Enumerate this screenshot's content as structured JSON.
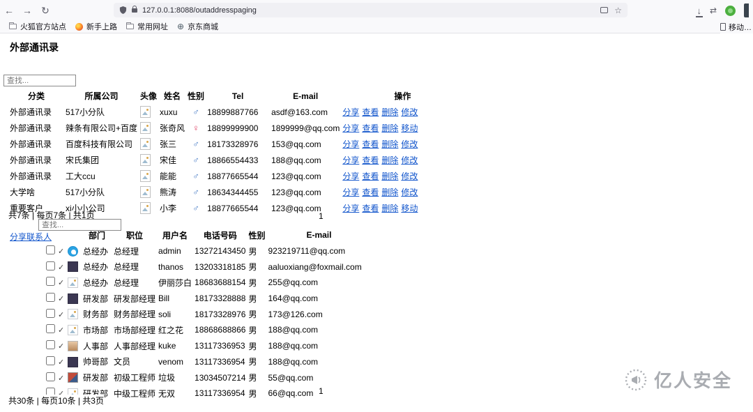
{
  "icons": {
    "back": "←",
    "forward": "→",
    "refresh": "↻",
    "star": "☆",
    "download": "↓",
    "sync": "⇄",
    "globe": "⊕",
    "check": "✓",
    "male": "♂",
    "female": "♀"
  },
  "browser": {
    "url": "127.0.0.1:8088/outaddresspaging",
    "bookmarks": [
      {
        "label": "火狐官方站点",
        "icon": "folder"
      },
      {
        "label": "新手上路",
        "icon": "firefox"
      },
      {
        "label": "常用网址",
        "icon": "folder"
      },
      {
        "label": "京东商城",
        "icon": "globe"
      }
    ],
    "bookmarks_overflow": "移动…"
  },
  "page": {
    "title": "外部通讯录",
    "search_placeholder": "查找...",
    "share_contacts_link": "分享联系人",
    "watermark": "亿人安全"
  },
  "external_table": {
    "headers": [
      "分类",
      "所属公司",
      "头像",
      "姓名",
      "性别",
      "Tel",
      "E-mail",
      "操作"
    ],
    "rows": [
      {
        "category": "外部通讯录",
        "company": "517小分队",
        "name": "xuxu",
        "gender": "male",
        "tel": "18899887766",
        "email": "asdf@163.com",
        "actions": [
          "分享",
          "查看",
          "删除",
          "修改"
        ]
      },
      {
        "category": "外部通讯录",
        "company": "辣条有限公司+百度",
        "name": "张奇风",
        "gender": "female",
        "tel": "18899999900",
        "email": "1899999@qq.com",
        "actions": [
          "分享",
          "查看",
          "删除",
          "移动"
        ]
      },
      {
        "category": "外部通讯录",
        "company": "百度科技有限公司",
        "name": "张三",
        "gender": "male",
        "tel": "18173328976",
        "email": "153@qq.com",
        "actions": [
          "分享",
          "查看",
          "删除",
          "修改"
        ]
      },
      {
        "category": "外部通讯录",
        "company": "宋氏集团",
        "name": "宋佳",
        "gender": "male",
        "tel": "18866554433",
        "email": "188@qq.com",
        "actions": [
          "分享",
          "查看",
          "删除",
          "修改"
        ]
      },
      {
        "category": "外部通讯录",
        "company": "工大ccu",
        "name": "能能",
        "gender": "male",
        "tel": "18877665544",
        "email": "123@qq.com",
        "actions": [
          "分享",
          "查看",
          "删除",
          "修改"
        ]
      },
      {
        "category": "大学啥",
        "company": "517小分队",
        "name": "熊涛",
        "gender": "male",
        "tel": "18634344455",
        "email": "123@qq.com",
        "actions": [
          "分享",
          "查看",
          "删除",
          "修改"
        ]
      },
      {
        "category": "重要客户",
        "company": "xi小小公司",
        "name": "小李",
        "gender": "male",
        "tel": "18877665544",
        "email": "123@qq.com",
        "actions": [
          "分享",
          "查看",
          "删除",
          "移动"
        ]
      }
    ],
    "summary": "共7条 | 每页7条 | 共1页",
    "page": "1"
  },
  "contacts_table": {
    "headers": [
      "部门",
      "职位",
      "用户名",
      "电话号码",
      "性别",
      "E-mail"
    ],
    "rows": [
      {
        "dept": "总经办",
        "position": "总经理",
        "username": "admin",
        "phone": "13272143450",
        "gender": "男",
        "email": "923219711@qq.com",
        "avatar": "badge-blue"
      },
      {
        "dept": "总经办",
        "position": "总经理",
        "username": "thanos",
        "phone": "13203318185",
        "gender": "男",
        "email": "aaluoxiang@foxmail.com",
        "avatar": "photo-dark"
      },
      {
        "dept": "总经办",
        "position": "总经理",
        "username": "伊丽莎白",
        "phone": "18683688154",
        "gender": "男",
        "email": "255@qq.com",
        "avatar": "placeholder"
      },
      {
        "dept": "研发部",
        "position": "研发部经理",
        "username": "Bill",
        "phone": "18173328888",
        "gender": "男",
        "email": "164@qq.com",
        "avatar": "photo-dark"
      },
      {
        "dept": "财务部",
        "position": "财务部经理",
        "username": "soli",
        "phone": "18173328976",
        "gender": "男",
        "email": "173@126.com",
        "avatar": "placeholder"
      },
      {
        "dept": "市场部",
        "position": "市场部经理",
        "username": "红之花",
        "phone": "18868688866",
        "gender": "男",
        "email": "188@qq.com",
        "avatar": "placeholder"
      },
      {
        "dept": "人事部",
        "position": "人事部经理",
        "username": "kuke",
        "phone": "13117336953",
        "gender": "男",
        "email": "188@qq.com",
        "avatar": "photo-light"
      },
      {
        "dept": "帅哥部",
        "position": "文员",
        "username": "venom",
        "phone": "13117336954",
        "gender": "男",
        "email": "188@qq.com",
        "avatar": "photo-dark"
      },
      {
        "dept": "研发部",
        "position": "初级工程师",
        "username": "垃圾",
        "phone": "13034507214",
        "gender": "男",
        "email": "55@qq.com",
        "avatar": "photo-red"
      },
      {
        "dept": "研发部",
        "position": "中级工程师",
        "username": "无双",
        "phone": "13117336954",
        "gender": "男",
        "email": "66@qq.com",
        "avatar": "placeholder"
      }
    ],
    "summary": "共30条 | 每页10条 | 共3页",
    "page": "1"
  }
}
